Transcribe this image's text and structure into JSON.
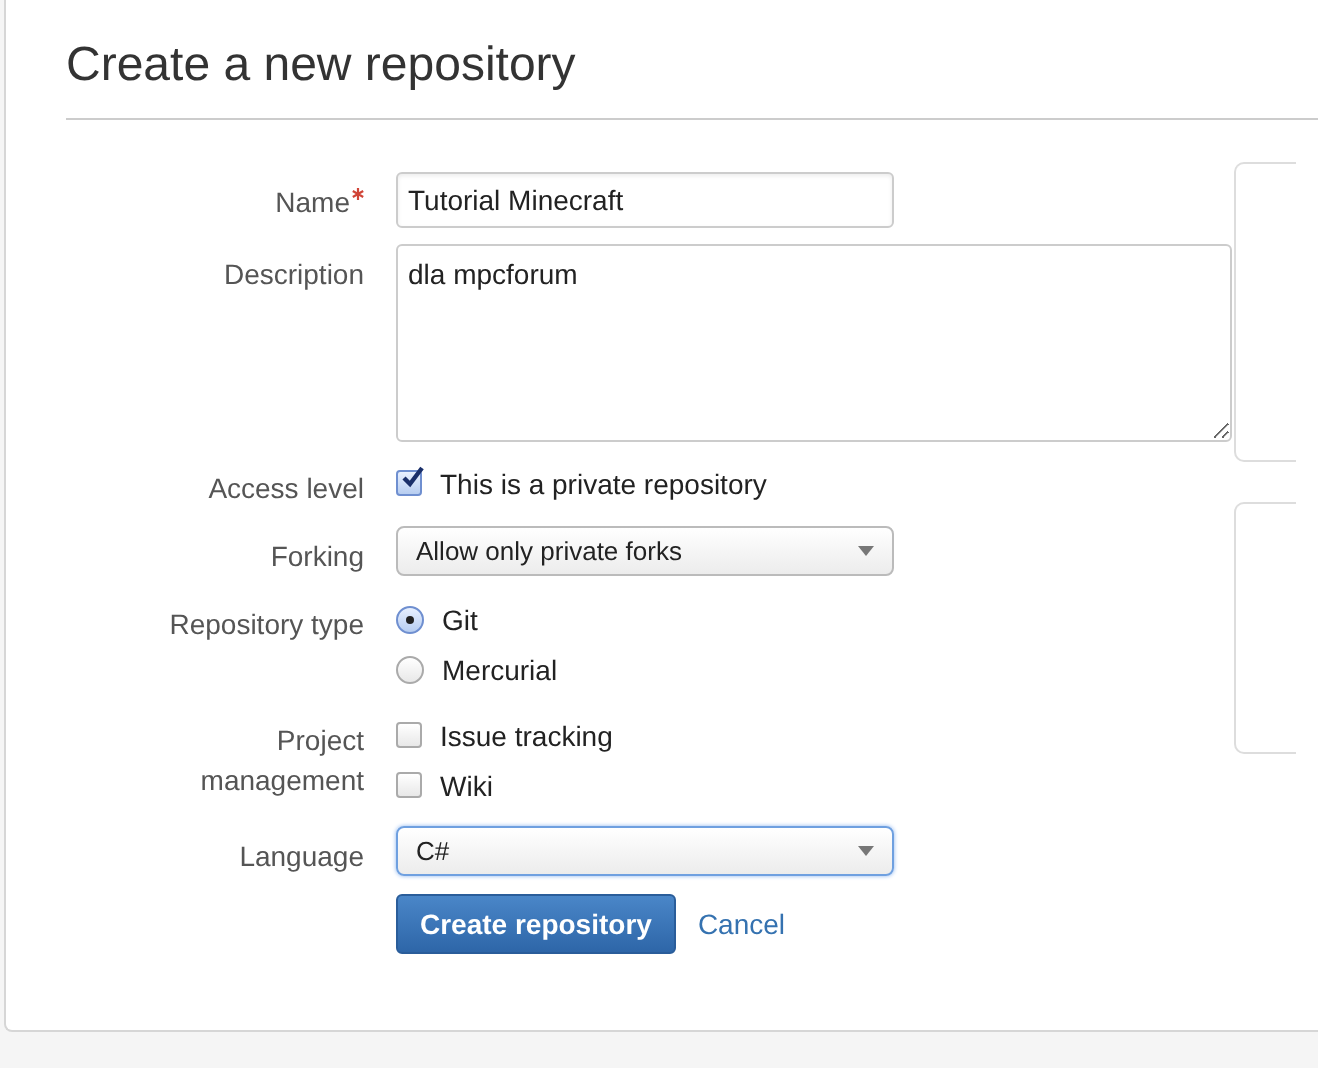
{
  "page": {
    "title": "Create a new repository"
  },
  "fields": [
    {
      "kind": "text",
      "label": "Name",
      "required": true,
      "value": "Tutorial Minecraft"
    },
    {
      "kind": "textarea",
      "label": "Description",
      "value": "dla mpcforum"
    },
    {
      "kind": "checkboxes",
      "label": "Access level",
      "options": [
        {
          "label": "This is a private repository",
          "checked": true
        }
      ]
    },
    {
      "kind": "select",
      "label": "Forking",
      "value": "Allow only private forks",
      "focused": false
    },
    {
      "kind": "radios",
      "label": "Repository type",
      "options": [
        {
          "label": "Git",
          "selected": true
        },
        {
          "label": "Mercurial",
          "selected": false
        }
      ]
    },
    {
      "kind": "checkboxes",
      "label": "Project management",
      "options": [
        {
          "label": "Issue tracking",
          "checked": false
        },
        {
          "label": "Wiki",
          "checked": false
        }
      ]
    },
    {
      "kind": "select",
      "label": "Language",
      "value": "C#",
      "focused": true
    }
  ],
  "actions": {
    "submit": "Create repository",
    "cancel": "Cancel"
  }
}
